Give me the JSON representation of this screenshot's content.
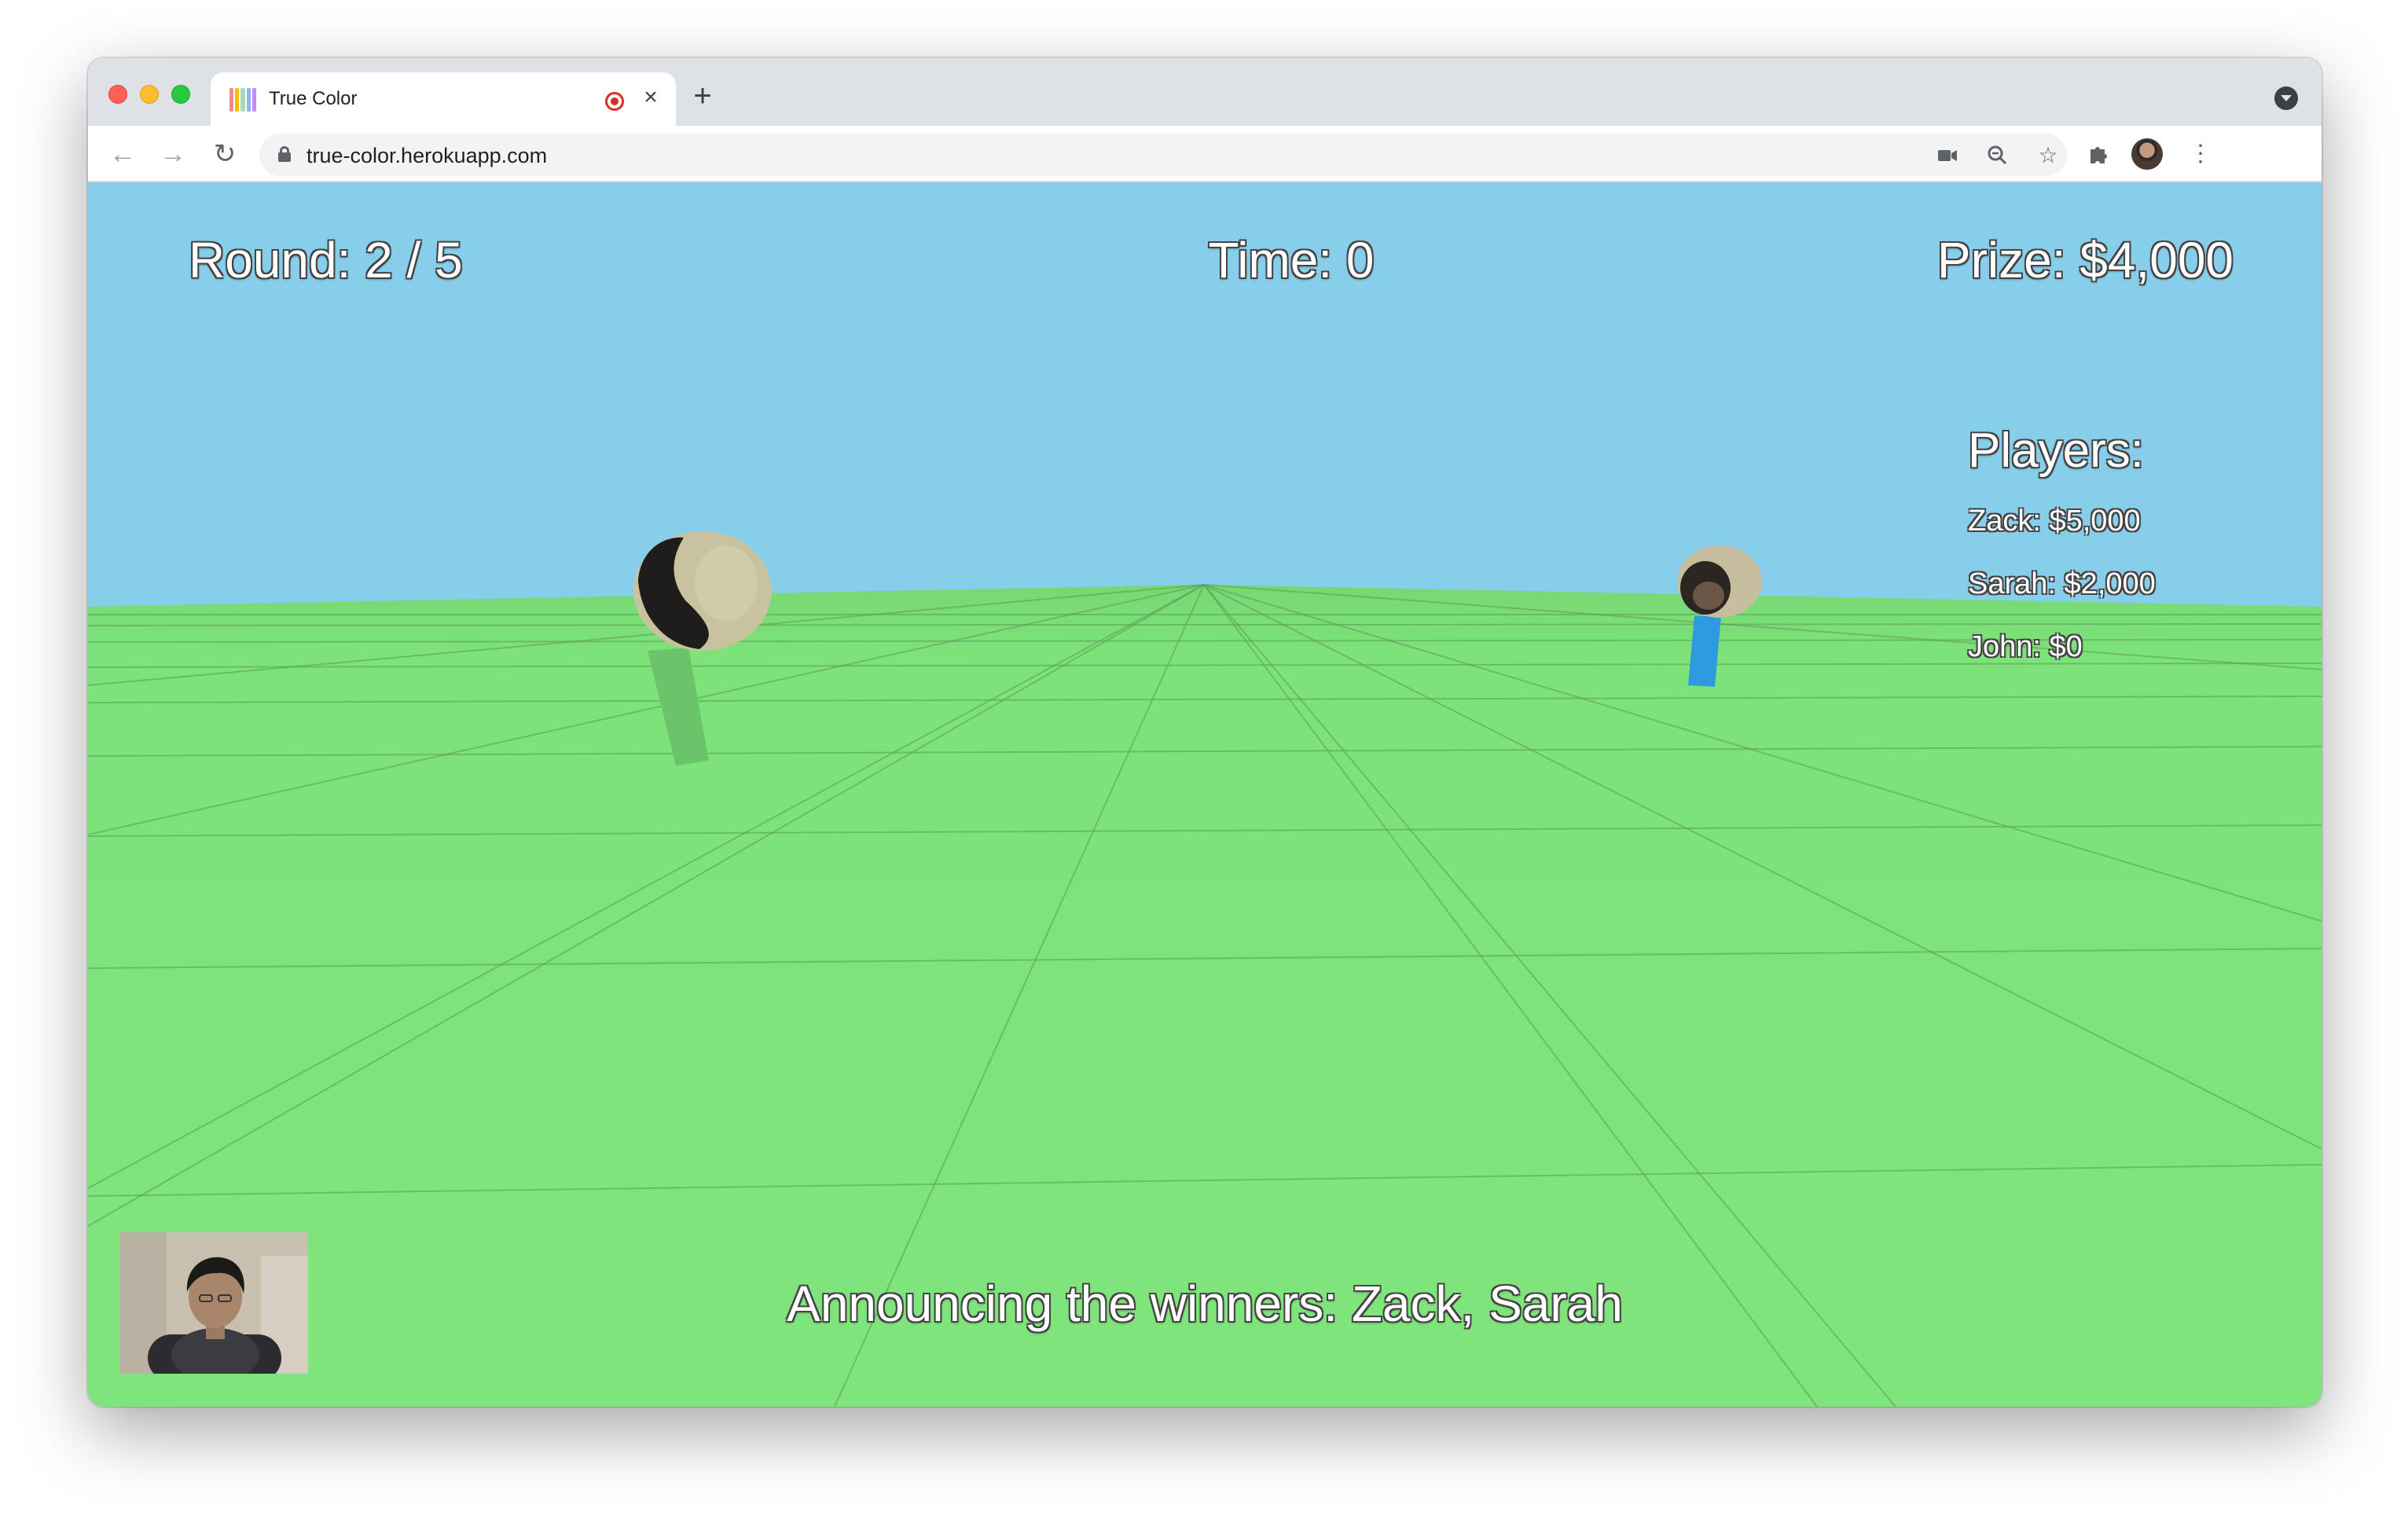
{
  "browser": {
    "tab_title": "True Color",
    "url": "true-color.herokuapp.com"
  },
  "game": {
    "round": "Round: 2 / 5",
    "time": "Time: 0",
    "prize": "Prize: $4,000",
    "players_heading": "Players:",
    "players": [
      {
        "label": "Zack: $5,000"
      },
      {
        "label": "Sarah: $2,000"
      },
      {
        "label": "John: $0"
      }
    ],
    "announcement": "Announcing the winners: Zack, Sarah"
  },
  "colors": {
    "sky": "#87ceeb",
    "ground": "#80e47c",
    "grid_line": "#5a9c56",
    "left_avatar_body": "#6cc46a",
    "right_avatar_body": "#2e9be0"
  }
}
